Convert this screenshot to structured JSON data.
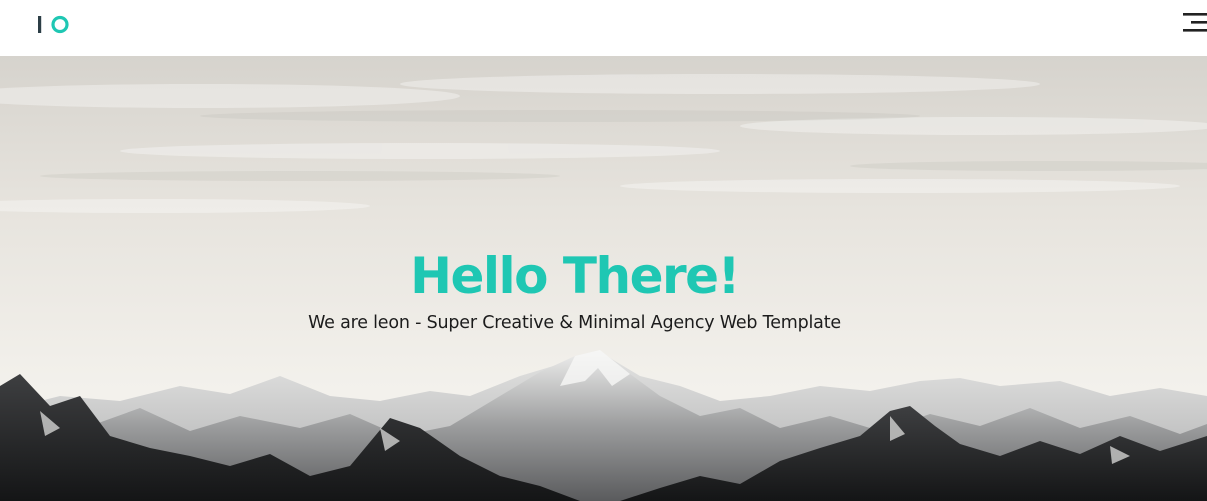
{
  "header": {
    "logo_icon": "io-logo-icon",
    "menu_icon": "hamburger-menu-icon"
  },
  "hero": {
    "title": "Hello There!",
    "subtitle": "We are leon - Super Creative & Minimal Agency Web Template",
    "background_image": "mountain-landscape-photo"
  },
  "colors": {
    "accent": "#1fc7b3",
    "logo_bar": "#2c3e46",
    "text_dark": "#1c1c1c",
    "header_bg": "#ffffff"
  }
}
